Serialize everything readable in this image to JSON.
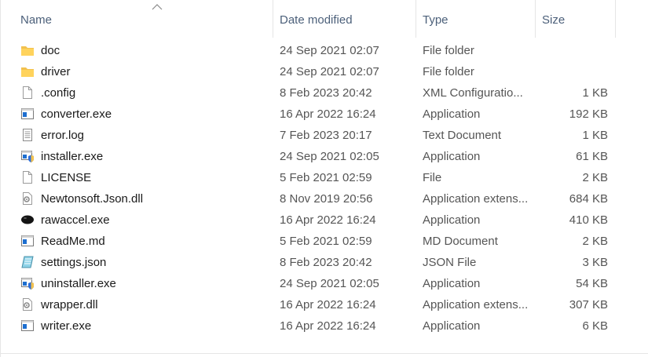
{
  "columns": {
    "name": "Name",
    "date": "Date modified",
    "type": "Type",
    "size": "Size"
  },
  "sort": {
    "column": "name",
    "direction": "ascending",
    "icon": "sort-up-arrow-icon"
  },
  "files": [
    {
      "icon": "folder-icon",
      "name": "doc",
      "date": "24 Sep 2021 02:07",
      "type": "File folder",
      "size": ""
    },
    {
      "icon": "folder-icon",
      "name": "driver",
      "date": "24 Sep 2021 02:07",
      "type": "File folder",
      "size": ""
    },
    {
      "icon": "blank-file-icon",
      "name": ".config",
      "date": "8 Feb 2023 20:42",
      "type": "XML Configuratio...",
      "size": "1 KB"
    },
    {
      "icon": "app-window-icon",
      "name": "converter.exe",
      "date": "16 Apr 2022 16:24",
      "type": "Application",
      "size": "192 KB"
    },
    {
      "icon": "text-document-icon",
      "name": "error.log",
      "date": "7 Feb 2023 20:17",
      "type": "Text Document",
      "size": "1 KB"
    },
    {
      "icon": "installer-shield-icon",
      "name": "installer.exe",
      "date": "24 Sep 2021 02:05",
      "type": "Application",
      "size": "61 KB"
    },
    {
      "icon": "blank-file-icon",
      "name": "LICENSE",
      "date": "5 Feb 2021 02:59",
      "type": "File",
      "size": "2 KB"
    },
    {
      "icon": "dll-gear-icon",
      "name": "Newtonsoft.Json.dll",
      "date": "8 Nov 2019 20:56",
      "type": "Application extens...",
      "size": "684 KB"
    },
    {
      "icon": "mouse-icon",
      "name": "rawaccel.exe",
      "date": "16 Apr 2022 16:24",
      "type": "Application",
      "size": "410 KB"
    },
    {
      "icon": "app-window-icon",
      "name": "ReadMe.md",
      "date": "5 Feb 2021 02:59",
      "type": "MD Document",
      "size": "2 KB"
    },
    {
      "icon": "notepad-icon",
      "name": "settings.json",
      "date": "8 Feb 2023 20:42",
      "type": "JSON File",
      "size": "3 KB"
    },
    {
      "icon": "installer-shield-icon",
      "name": "uninstaller.exe",
      "date": "24 Sep 2021 02:05",
      "type": "Application",
      "size": "54 KB"
    },
    {
      "icon": "dll-gear-icon",
      "name": "wrapper.dll",
      "date": "16 Apr 2022 16:24",
      "type": "Application extens...",
      "size": "307 KB"
    },
    {
      "icon": "app-window-icon",
      "name": "writer.exe",
      "date": "16 Apr 2022 16:24",
      "type": "Application",
      "size": "6 KB"
    }
  ],
  "colors": {
    "header_text": "#4c607a",
    "folder": "#f2c14e",
    "app_blue": "#1e6fd0"
  }
}
